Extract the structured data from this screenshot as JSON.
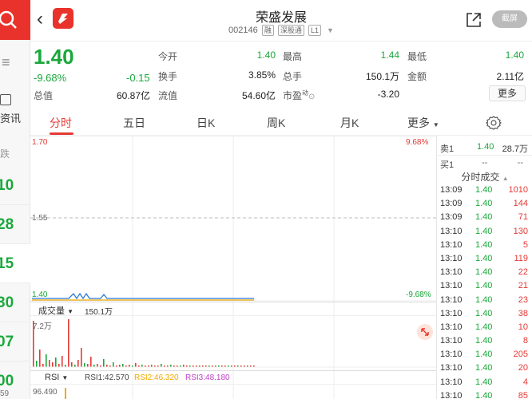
{
  "sidebar": {
    "menu_glyph": "≡",
    "zixun": "资讯",
    "die": "跌",
    "rows": [
      "10",
      "28",
      "15",
      "30",
      "07",
      "00"
    ],
    "last": "59"
  },
  "header": {
    "title": "荣盛发展",
    "code": "002146",
    "tags": [
      "融",
      "深股通",
      "L1"
    ],
    "screenshot_btn": "截屏"
  },
  "quote": {
    "price": "1.40",
    "change_pct": "-9.68%",
    "change": "-0.15",
    "fields": [
      {
        "label": "今开",
        "value": "1.40",
        "color": "green"
      },
      {
        "label": "最高",
        "value": "1.44",
        "color": "green"
      },
      {
        "label": "最低",
        "value": "1.40",
        "color": "green"
      },
      {
        "label": "换手",
        "value": "3.85%",
        "color": "black"
      },
      {
        "label": "总手",
        "value": "150.1万",
        "color": "black"
      },
      {
        "label": "金额",
        "value": "2.11亿",
        "color": "black"
      },
      {
        "label": "总值",
        "value": "60.87亿",
        "color": "black"
      },
      {
        "label": "流值",
        "value": "54.60亿",
        "color": "black"
      },
      {
        "label": "市盈",
        "value": "-3.20",
        "color": "black"
      }
    ],
    "pe_sup": "动",
    "more": "更多"
  },
  "tabs": [
    "分时",
    "五日",
    "日K",
    "周K",
    "月K",
    "更多"
  ],
  "chart": {
    "y_top": "1.70",
    "y_mid": "1.55",
    "y_bot": "1.40",
    "pct_top": "9.68%",
    "pct_bot": "-9.68%",
    "vol_label": "成交量",
    "vol_value": "150.1万",
    "vol_max": "7.2万",
    "rsi_label": "RSI",
    "rsi1": "RSI1:42.570",
    "rsi2": "RSI2:46.320",
    "rsi3": "RSI3:48.180",
    "rsi_axis": "96.490"
  },
  "book": {
    "sell1_label": "卖1",
    "sell1_price": "1.40",
    "sell1_vol": "28.7万",
    "buy1_label": "买1",
    "buy1_price": "--",
    "buy1_vol": "--",
    "trades_title": "分时成交"
  },
  "trades": [
    {
      "time": "13:09",
      "price": "1.40",
      "vol": "1010"
    },
    {
      "time": "13:09",
      "price": "1.40",
      "vol": "144"
    },
    {
      "time": "13:09",
      "price": "1.40",
      "vol": "71"
    },
    {
      "time": "13:10",
      "price": "1.40",
      "vol": "130"
    },
    {
      "time": "13:10",
      "price": "1.40",
      "vol": "5"
    },
    {
      "time": "13:10",
      "price": "1.40",
      "vol": "119"
    },
    {
      "time": "13:10",
      "price": "1.40",
      "vol": "22"
    },
    {
      "time": "13:10",
      "price": "1.40",
      "vol": "21"
    },
    {
      "time": "13:10",
      "price": "1.40",
      "vol": "23"
    },
    {
      "time": "13:10",
      "price": "1.40",
      "vol": "38"
    },
    {
      "time": "13:10",
      "price": "1.40",
      "vol": "10"
    },
    {
      "time": "13:10",
      "price": "1.40",
      "vol": "8"
    },
    {
      "time": "13:10",
      "price": "1.40",
      "vol": "205"
    },
    {
      "time": "13:10",
      "price": "1.40",
      "vol": "20"
    },
    {
      "time": "13:10",
      "price": "1.40",
      "vol": "4"
    },
    {
      "time": "13:10",
      "price": "1.40",
      "vol": "85"
    }
  ],
  "colors": {
    "up": "#e53935",
    "down": "#19a83a",
    "brand": "#e8322b"
  }
}
